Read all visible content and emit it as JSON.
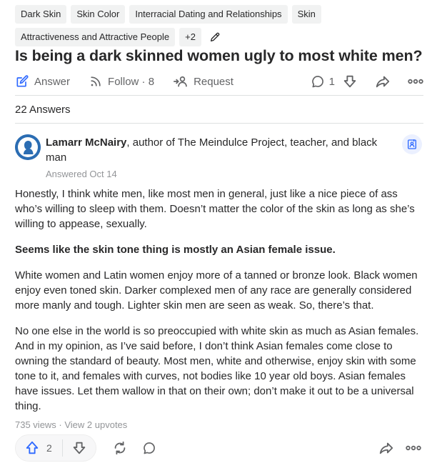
{
  "topics": [
    "Dark Skin",
    "Skin Color",
    "Interracial Dating and Relationships",
    "Skin",
    "Attractiveness and Attractive People"
  ],
  "topics_more": "+2",
  "question": "Is being a dark skinned women ugly to most white men?",
  "question_actions": {
    "answer_label": "Answer",
    "follow_label": "Follow · 8",
    "request_label": "Request",
    "comment_count": "1"
  },
  "answers_count": "22 Answers",
  "answer": {
    "author_name": "Lamarr McNairy",
    "author_credential": ", author of The Meindulce Project, teacher, and black man",
    "answered_date": "Answered Oct 14",
    "paragraphs": [
      {
        "text": "Honestly, I think white men, like most men in general, just like a nice piece of ass who’s willing to sleep with them. Doesn’t matter the color of the skin as long as she’s willing to appease, sexually.",
        "bold": false
      },
      {
        "text": "Seems like the skin tone thing is mostly an Asian female issue.",
        "bold": true
      },
      {
        "text": "White women and Latin women enjoy more of a tanned or bronze look. Black women enjoy even toned skin. Darker complexed men of any race are generally considered more manly and tough. Lighter skin men are seen as weak. So, there’s that.",
        "bold": false
      },
      {
        "text": "No one else in the world is so preoccupied with white skin as much as Asian females. And in my opinion, as I’ve said before, I don’t think Asian females come close to owning the standard of beauty. Most men, white and otherwise, enjoy skin with some tone to it, and females with curves, not bodies like 10 year old boys. Asian females have issues. Let them wallow in that on their own; don’t make it out to be a universal thing.",
        "bold": false
      }
    ],
    "stats": "735 views · View 2 upvotes",
    "upvote_count": "2"
  },
  "colors": {
    "blue": "#2e69ff",
    "text": "#282829",
    "muted": "#636466",
    "light": "#939598"
  },
  "icons": [
    "pencil-icon",
    "answer-pen-icon",
    "follow-rss-icon",
    "request-icon",
    "comment-icon",
    "downvote-icon",
    "share-icon",
    "more-icon",
    "upvote-icon",
    "reshare-icon",
    "credential-icon"
  ]
}
